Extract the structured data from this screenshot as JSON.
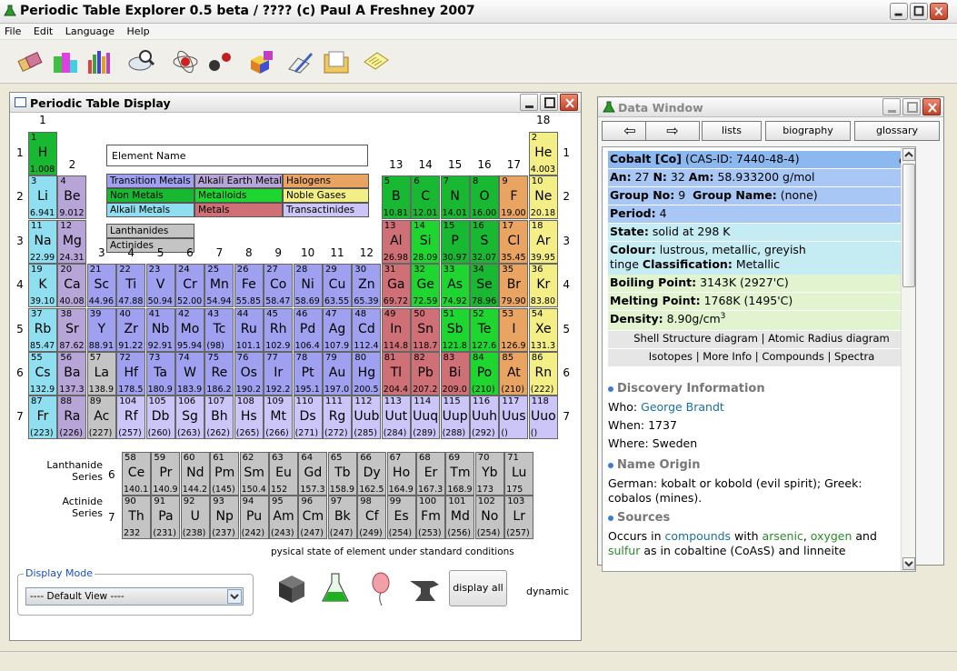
{
  "app": {
    "title": "Periodic Table Explorer 0.5 beta / ???? (c) Paul A Freshney 2007"
  },
  "menu": [
    "File",
    "Edit",
    "Language",
    "Help"
  ],
  "toolbar": [
    "elements-icon",
    "blocks-icon",
    "chart-icon",
    "search-icon",
    "atom-icon",
    "molecule-icon",
    "cubes-icon",
    "pen-icon",
    "folder-icon",
    "notes-icon"
  ],
  "pt_window": {
    "title": "Periodic Table Display",
    "element_name": "Element Name",
    "legend": [
      {
        "label": "Transition Metals",
        "cls": "c-tm"
      },
      {
        "label": "Alkali Earth Metals",
        "cls": "c-ae"
      },
      {
        "label": "Halogens",
        "cls": "c-hal"
      },
      {
        "label": "Non Metals",
        "cls": "c-nm"
      },
      {
        "label": "Metalloids",
        "cls": "c-met"
      },
      {
        "label": "Noble Gases",
        "cls": "c-ng"
      },
      {
        "label": "Alkali Metals",
        "cls": "c-am"
      },
      {
        "label": "Metals",
        "cls": "c-mt"
      },
      {
        "label": "Transactinides",
        "cls": "c-tr"
      },
      {
        "label": "Lanthanides",
        "cls": "c-ln"
      },
      {
        "label": "Actinides",
        "cls": "c-ac"
      }
    ],
    "groups": [
      "1",
      "2",
      "3",
      "4",
      "5",
      "6",
      "7",
      "8",
      "9",
      "10",
      "11",
      "12",
      "13",
      "14",
      "15",
      "16",
      "17",
      "18"
    ],
    "periods": [
      "1",
      "2",
      "3",
      "4",
      "5",
      "6",
      "7"
    ],
    "lanthanide_label": "Lanthanide Series",
    "actinide_label": "Actinide Series",
    "ln_period": "6",
    "ac_period": "7",
    "state_caption": "pysical state of element under standard conditions",
    "display_all": "display all",
    "dynamic": "dynamic",
    "display_mode_label": "Display Mode",
    "display_mode_value": "---- Default View ----",
    "elements": [
      [
        1,
        "H",
        "1.008",
        1,
        1,
        "c-nm"
      ],
      [
        2,
        "He",
        "4.003",
        18,
        1,
        "c-ng"
      ],
      [
        3,
        "Li",
        "6.941",
        1,
        2,
        "c-am"
      ],
      [
        4,
        "Be",
        "9.012",
        2,
        2,
        "c-ae"
      ],
      [
        5,
        "B",
        "10.81",
        13,
        2,
        "c-nm"
      ],
      [
        6,
        "C",
        "12.01",
        14,
        2,
        "c-nm"
      ],
      [
        7,
        "N",
        "14.01",
        15,
        2,
        "c-nm"
      ],
      [
        8,
        "O",
        "16.00",
        16,
        2,
        "c-nm"
      ],
      [
        9,
        "F",
        "19.00",
        17,
        2,
        "c-hal"
      ],
      [
        10,
        "Ne",
        "20.18",
        18,
        2,
        "c-ng"
      ],
      [
        11,
        "Na",
        "22.99",
        1,
        3,
        "c-am"
      ],
      [
        12,
        "Mg",
        "24.31",
        2,
        3,
        "c-ae"
      ],
      [
        13,
        "Al",
        "26.98",
        13,
        3,
        "c-mt"
      ],
      [
        14,
        "Si",
        "28.09",
        14,
        3,
        "c-met"
      ],
      [
        15,
        "P",
        "30.97",
        15,
        3,
        "c-nm"
      ],
      [
        16,
        "S",
        "32.07",
        16,
        3,
        "c-nm"
      ],
      [
        17,
        "Cl",
        "35.45",
        17,
        3,
        "c-hal"
      ],
      [
        18,
        "Ar",
        "39.95",
        18,
        3,
        "c-ng"
      ],
      [
        19,
        "K",
        "39.10",
        1,
        4,
        "c-am"
      ],
      [
        20,
        "Ca",
        "40.08",
        2,
        4,
        "c-ae"
      ],
      [
        21,
        "Sc",
        "44.96",
        3,
        4,
        "c-tm"
      ],
      [
        22,
        "Ti",
        "47.88",
        4,
        4,
        "c-tm"
      ],
      [
        23,
        "V",
        "50.94",
        5,
        4,
        "c-tm"
      ],
      [
        24,
        "Cr",
        "52.00",
        6,
        4,
        "c-tm"
      ],
      [
        25,
        "Mn",
        "54.94",
        7,
        4,
        "c-tm"
      ],
      [
        26,
        "Fe",
        "55.85",
        8,
        4,
        "c-tm"
      ],
      [
        27,
        "Co",
        "58.47",
        9,
        4,
        "c-tm"
      ],
      [
        28,
        "Ni",
        "58.69",
        10,
        4,
        "c-tm"
      ],
      [
        29,
        "Cu",
        "63.55",
        11,
        4,
        "c-tm"
      ],
      [
        30,
        "Zn",
        "65.39",
        12,
        4,
        "c-tm"
      ],
      [
        31,
        "Ga",
        "69.72",
        13,
        4,
        "c-mt"
      ],
      [
        32,
        "Ge",
        "72.59",
        14,
        4,
        "c-met"
      ],
      [
        33,
        "As",
        "74.92",
        15,
        4,
        "c-met"
      ],
      [
        34,
        "Se",
        "78.96",
        16,
        4,
        "c-nm"
      ],
      [
        35,
        "Br",
        "79.90",
        17,
        4,
        "c-hal"
      ],
      [
        36,
        "Kr",
        "83.80",
        18,
        4,
        "c-ng"
      ],
      [
        37,
        "Rb",
        "85.47",
        1,
        5,
        "c-am"
      ],
      [
        38,
        "Sr",
        "87.62",
        2,
        5,
        "c-ae"
      ],
      [
        39,
        "Y",
        "88.91",
        3,
        5,
        "c-tm"
      ],
      [
        40,
        "Zr",
        "91.22",
        4,
        5,
        "c-tm"
      ],
      [
        41,
        "Nb",
        "92.91",
        5,
        5,
        "c-tm"
      ],
      [
        42,
        "Mo",
        "95.94",
        6,
        5,
        "c-tm"
      ],
      [
        43,
        "Tc",
        "(98)",
        7,
        5,
        "c-tm"
      ],
      [
        44,
        "Ru",
        "101.1",
        8,
        5,
        "c-tm"
      ],
      [
        45,
        "Rh",
        "102.9",
        9,
        5,
        "c-tm"
      ],
      [
        46,
        "Pd",
        "106.4",
        10,
        5,
        "c-tm"
      ],
      [
        47,
        "Ag",
        "107.9",
        11,
        5,
        "c-tm"
      ],
      [
        48,
        "Cd",
        "112.4",
        12,
        5,
        "c-tm"
      ],
      [
        49,
        "In",
        "114.8",
        13,
        5,
        "c-mt"
      ],
      [
        50,
        "Sn",
        "118.7",
        14,
        5,
        "c-mt"
      ],
      [
        51,
        "Sb",
        "121.8",
        15,
        5,
        "c-met"
      ],
      [
        52,
        "Te",
        "127.6",
        16,
        5,
        "c-met"
      ],
      [
        53,
        "I",
        "126.9",
        17,
        5,
        "c-hal"
      ],
      [
        54,
        "Xe",
        "131.3",
        18,
        5,
        "c-ng"
      ],
      [
        55,
        "Cs",
        "132.9",
        1,
        6,
        "c-am"
      ],
      [
        56,
        "Ba",
        "137.3",
        2,
        6,
        "c-ae"
      ],
      [
        57,
        "La",
        "138.9",
        3,
        6,
        "c-ln"
      ],
      [
        72,
        "Hf",
        "178.5",
        4,
        6,
        "c-tm"
      ],
      [
        73,
        "Ta",
        "180.9",
        5,
        6,
        "c-tm"
      ],
      [
        74,
        "W",
        "183.9",
        6,
        6,
        "c-tm"
      ],
      [
        75,
        "Re",
        "186.2",
        7,
        6,
        "c-tm"
      ],
      [
        76,
        "Os",
        "190.2",
        8,
        6,
        "c-tm"
      ],
      [
        77,
        "Ir",
        "192.2",
        9,
        6,
        "c-tm"
      ],
      [
        78,
        "Pt",
        "195.1",
        10,
        6,
        "c-tm"
      ],
      [
        79,
        "Au",
        "197.0",
        11,
        6,
        "c-tm"
      ],
      [
        80,
        "Hg",
        "200.5",
        12,
        6,
        "c-tm"
      ],
      [
        81,
        "Tl",
        "204.4",
        13,
        6,
        "c-mt"
      ],
      [
        82,
        "Pb",
        "207.2",
        14,
        6,
        "c-mt"
      ],
      [
        83,
        "Bi",
        "209.0",
        15,
        6,
        "c-mt"
      ],
      [
        84,
        "Po",
        "(210)",
        16,
        6,
        "c-met"
      ],
      [
        85,
        "At",
        "(210)",
        17,
        6,
        "c-hal"
      ],
      [
        86,
        "Rn",
        "(222)",
        18,
        6,
        "c-ng"
      ],
      [
        87,
        "Fr",
        "(223)",
        1,
        7,
        "c-am"
      ],
      [
        88,
        "Ra",
        "(226)",
        2,
        7,
        "c-ae"
      ],
      [
        89,
        "Ac",
        "(227)",
        3,
        7,
        "c-ac"
      ],
      [
        104,
        "Rf",
        "(257)",
        4,
        7,
        "c-tr"
      ],
      [
        105,
        "Db",
        "(260)",
        5,
        7,
        "c-tr"
      ],
      [
        106,
        "Sg",
        "(263)",
        6,
        7,
        "c-tr"
      ],
      [
        107,
        "Bh",
        "(262)",
        7,
        7,
        "c-tr"
      ],
      [
        108,
        "Hs",
        "(265)",
        8,
        7,
        "c-tr"
      ],
      [
        109,
        "Mt",
        "(266)",
        9,
        7,
        "c-tr"
      ],
      [
        110,
        "Ds",
        "(271)",
        10,
        7,
        "c-tr"
      ],
      [
        111,
        "Rg",
        "(272)",
        11,
        7,
        "c-tr"
      ],
      [
        112,
        "Uub",
        "(285)",
        12,
        7,
        "c-tr"
      ],
      [
        113,
        "Uut",
        "(284)",
        13,
        7,
        "c-tr"
      ],
      [
        114,
        "Uuq",
        "(289)",
        14,
        7,
        "c-tr"
      ],
      [
        115,
        "Uup",
        "(288)",
        15,
        7,
        "c-tr"
      ],
      [
        116,
        "Uuh",
        "(292)",
        16,
        7,
        "c-tr"
      ],
      [
        117,
        "Uus",
        "()",
        17,
        7,
        "c-tr"
      ],
      [
        118,
        "Uuo",
        "()",
        18,
        7,
        "c-tr"
      ]
    ],
    "lanthanides": [
      [
        58,
        "Ce",
        "140.1"
      ],
      [
        59,
        "Pr",
        "140.9"
      ],
      [
        60,
        "Nd",
        "144.2"
      ],
      [
        61,
        "Pm",
        "(145)"
      ],
      [
        62,
        "Sm",
        "150.4"
      ],
      [
        63,
        "Eu",
        "152"
      ],
      [
        64,
        "Gd",
        "157.3"
      ],
      [
        65,
        "Tb",
        "158.9"
      ],
      [
        66,
        "Dy",
        "162.5"
      ],
      [
        67,
        "Ho",
        "164.9"
      ],
      [
        68,
        "Er",
        "167.3"
      ],
      [
        69,
        "Tm",
        "168.9"
      ],
      [
        70,
        "Yb",
        "173"
      ],
      [
        71,
        "Lu",
        "175"
      ]
    ],
    "actinides": [
      [
        90,
        "Th",
        "232"
      ],
      [
        91,
        "Pa",
        "(231)"
      ],
      [
        92,
        "U",
        "(238)"
      ],
      [
        93,
        "Np",
        "(237)"
      ],
      [
        94,
        "Pu",
        "(242)"
      ],
      [
        95,
        "Am",
        "(243)"
      ],
      [
        96,
        "Cm",
        "(247)"
      ],
      [
        97,
        "Bk",
        "(247)"
      ],
      [
        98,
        "Cf",
        "(249)"
      ],
      [
        99,
        "Es",
        "(254)"
      ],
      [
        100,
        "Fm",
        "(253)"
      ],
      [
        101,
        "Md",
        "(256)"
      ],
      [
        102,
        "No",
        "(254)"
      ],
      [
        103,
        "Lr",
        "(257)"
      ]
    ]
  },
  "data_window": {
    "title": "Data Window",
    "nav": {
      "back": "⇦",
      "forward": "⇨",
      "lists": "lists",
      "biography": "biography",
      "glossary": "glossary"
    },
    "header": "Cobalt [Co]",
    "cas": "(CAS-ID: 7440-48-4)",
    "an_label": "An:",
    "an": "27",
    "n_label": "N:",
    "n": "32",
    "am_label": "Am:",
    "am": "58.933200 g/mol",
    "group_label": "Group No:",
    "group": "9",
    "gname_label": "Group Name:",
    "gname": "(none)",
    "period_label": "Period:",
    "period": "4",
    "state_label": "State:",
    "state": "solid at 298 K",
    "colour_label": "Colour:",
    "colour": "lustrous, metallic, greyish",
    "colour_cont": "tinge",
    "class_label": "Classification:",
    "class": "Metallic",
    "bp_label": "Boiling Point:",
    "bp": "3143K (2927'C)",
    "mp_label": "Melting Point:",
    "mp": "1768K (1495'C)",
    "density_label": "Density:",
    "density": "8.90g/cm",
    "density_exp": "3",
    "links1": "Shell Structure diagram | Atomic Radius diagram",
    "links2": "Isotopes | More Info | Compounds | Spectra",
    "disc_title": "Discovery Information",
    "who_label": "Who:",
    "who": "George Brandt",
    "when_label": "When:",
    "when": "1737",
    "where_label": "Where:",
    "where": "Sweden",
    "name_title": "Name Origin",
    "name_text": "German: kobalt or kobold (evil spirit); Greek: cobalos (mines).",
    "sources_title": "Sources",
    "src_a": "Occurs in ",
    "src_b": "compounds",
    "src_c": " with ",
    "src_d": "arsenic",
    "src_e": ", ",
    "src_f": "oxygen",
    "src_g": " and",
    "src_h": "sulfur",
    "src_i": " as in cobaltine (CoAsS) and linneite",
    "colors": {
      "row_blue": "#a9c7f5",
      "row_cyan": "#c6ecf3",
      "row_green": "#e2f3cf",
      "row_grey": "#e6e6e6"
    }
  }
}
